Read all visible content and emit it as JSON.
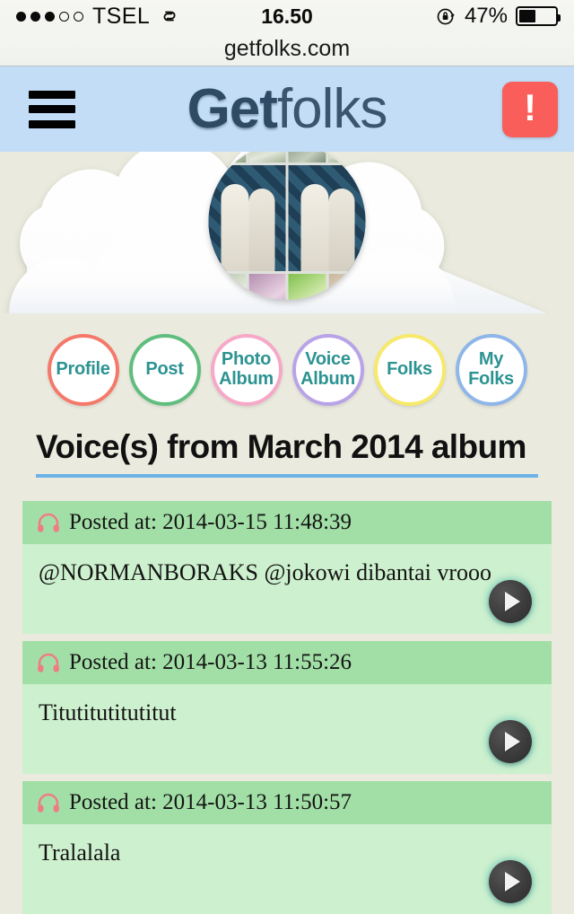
{
  "statusbar": {
    "signal_filled": 3,
    "signal_total": 5,
    "carrier": "TSEL",
    "sync_icon": "link-sync-icon",
    "time": "16.50",
    "rotation_lock_icon": "rotation-lock-icon",
    "battery_percent": "47%",
    "battery_level": 47
  },
  "urlbar": {
    "url": "getfolks.com"
  },
  "header": {
    "menu_icon": "hamburger-menu-icon",
    "logo_first": "Get",
    "logo_second": "folks",
    "alert_label": "!",
    "bg_color": "#c3ddf7",
    "alert_color": "#f95e5a"
  },
  "profile": {
    "avatar_alt": "profile-photo-collage",
    "cloud_color": "#ffffff"
  },
  "nav": {
    "items": [
      {
        "label": "Profile",
        "lines": [
          "Profile"
        ],
        "color": "#f4796b"
      },
      {
        "label": "Post",
        "lines": [
          "Post"
        ],
        "color": "#5fbd7e"
      },
      {
        "label": "Photo Album",
        "lines": [
          "Photo",
          "Album"
        ],
        "color": "#f7a8c8"
      },
      {
        "label": "Voice Album",
        "lines": [
          "Voice",
          "Album"
        ],
        "color": "#b9a3e8"
      },
      {
        "label": "Folks",
        "lines": [
          "Folks"
        ],
        "color": "#f7e96a"
      },
      {
        "label": "My Folks",
        "lines": [
          "My",
          "Folks"
        ],
        "color": "#8fb6e8"
      }
    ],
    "text_color": "#2d9392"
  },
  "page": {
    "title": "Voice(s) from March 2014 album",
    "underline_color": "#6db3e8"
  },
  "voices": {
    "posted_prefix": "Posted at: ",
    "headphone_icon": "headphone-icon",
    "play_icon": "play-button-icon",
    "head_bg": "#a2dfa6",
    "body_bg": "#cdf0ce",
    "items": [
      {
        "timestamp": "2014-03-15 11:48:39",
        "message": "@NORMANBORAKS @jokowi dibantai vrooo"
      },
      {
        "timestamp": "2014-03-13 11:55:26",
        "message": "Titutitutitutitut"
      },
      {
        "timestamp": "2014-03-13 11:50:57",
        "message": "Tralalala"
      }
    ]
  }
}
